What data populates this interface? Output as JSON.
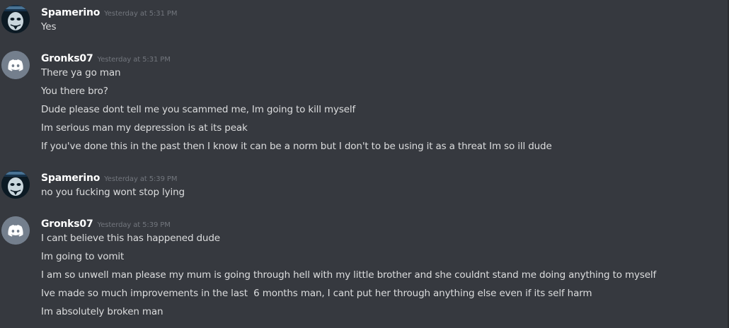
{
  "groups": [
    {
      "username": "Spamerino",
      "timestamp": "Yesterday at 5:31 PM",
      "avatar_icon": "masked-face-avatar-icon",
      "messages": [
        "Yes"
      ]
    },
    {
      "username": "Gronks07",
      "timestamp": "Yesterday at 5:31 PM",
      "avatar_icon": "discord-default-avatar-icon",
      "messages": [
        "There ya go man",
        "You there bro?",
        "Dude please dont tell me you scammed me, Im going to kill myself",
        "Im serious man my depression is at its peak",
        "If you've done this in the past then I know it can be a norm but I don't to be using it as a threat Im so ill dude"
      ]
    },
    {
      "username": "Spamerino",
      "timestamp": "Yesterday at 5:39 PM",
      "avatar_icon": "masked-face-avatar-icon",
      "messages": [
        "no you fucking wont stop lying"
      ]
    },
    {
      "username": "Gronks07",
      "timestamp": "Yesterday at 5:39 PM",
      "avatar_icon": "discord-default-avatar-icon",
      "messages": [
        "I cant believe this has happened dude",
        "Im going to vomit",
        "I am so unwell man please my mum is going through hell with my little brother and she couldnt stand me doing anything to myself",
        "Ive made so much improvements in the last  6 months man, I cant put her through anything else even if its self harm",
        "Im absolutely broken man"
      ]
    }
  ],
  "colors": {
    "background": "#36393f",
    "username": "#ffffff",
    "timestamp": "#72767d",
    "message_text": "#dcddde",
    "discord_avatar_bg": "#747f8d"
  }
}
